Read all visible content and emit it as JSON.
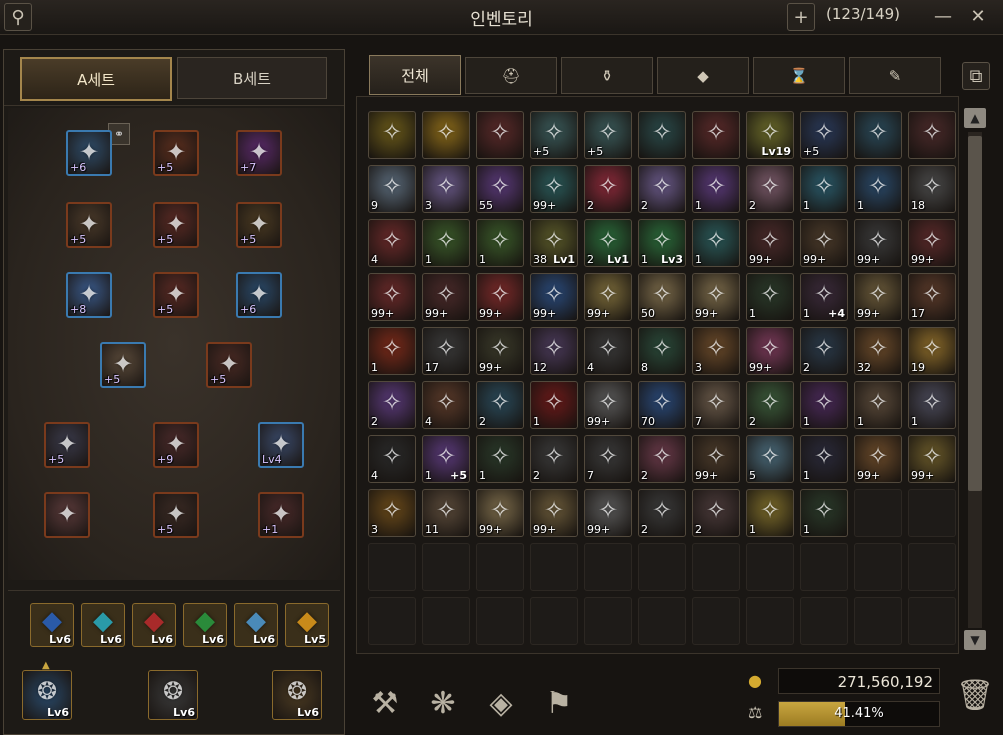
{
  "window": {
    "title": "인벤토리",
    "slot_count": "(123/149)",
    "icons": [
      "profile-search-icon",
      "plus-icon",
      "minimize-icon",
      "close-icon"
    ]
  },
  "sets": {
    "a": "A세트",
    "b": "B세트",
    "active": "a"
  },
  "equipment": [
    {
      "name": "helmet",
      "label": "+6",
      "color": "#2f4d6a"
    },
    {
      "name": "shoulder",
      "label": "+5",
      "color": "#5a2e1e"
    },
    {
      "name": "wing",
      "label": "+7",
      "color": "#5a2a6a"
    },
    {
      "name": "weapon",
      "label": "+5",
      "color": "#4a3a2a"
    },
    {
      "name": "chest",
      "label": "+5",
      "color": "#5a2a24"
    },
    {
      "name": "gloves",
      "label": "+5",
      "color": "#4a3a22"
    },
    {
      "name": "cloak",
      "label": "+8",
      "color": "#3a5a8a"
    },
    {
      "name": "pants",
      "label": "+5",
      "color": "#5a2a24"
    },
    {
      "name": "boots",
      "label": "+6",
      "color": "#2a4a6a"
    },
    {
      "name": "belt",
      "label": "+5",
      "color": "#5a4a3a"
    },
    {
      "name": "relic",
      "label": "+5",
      "color": "#4a2a24"
    },
    {
      "name": "necklace",
      "label": "+5",
      "color": "#3a3a4a"
    },
    {
      "name": "earring",
      "label": "+9",
      "color": "#4a2a2a"
    },
    {
      "name": "bracelet",
      "label": "Lv4",
      "color": "#3a4a6a"
    },
    {
      "name": "ring-wing",
      "label": "",
      "color": "#5a3a3a"
    },
    {
      "name": "ring-left",
      "label": "+5",
      "color": "#3a2a24"
    },
    {
      "name": "ring-right",
      "label": "+1",
      "color": "#4a2a2a"
    }
  ],
  "gems": [
    {
      "name": "sapphire",
      "lv": "Lv6",
      "color": "#2a5aa8"
    },
    {
      "name": "aquamarine",
      "lv": "Lv6",
      "color": "#2a9aa8"
    },
    {
      "name": "ruby",
      "lv": "Lv6",
      "color": "#a82a2a"
    },
    {
      "name": "emerald",
      "lv": "Lv6",
      "color": "#2a8a3a"
    },
    {
      "name": "opal",
      "lv": "Lv6",
      "color": "#4a8ab8"
    },
    {
      "name": "topaz",
      "lv": "Lv5",
      "color": "#c88a1a"
    }
  ],
  "artifacts": [
    {
      "name": "chain",
      "lv": "Lv6",
      "color": "#2a4a6a"
    },
    {
      "name": "bell",
      "lv": "Lv6",
      "color": "#3a3a3a"
    },
    {
      "name": "amulet",
      "lv": "Lv6",
      "color": "#4a3a22"
    }
  ],
  "category_tabs": [
    {
      "name": "all",
      "label": "전체"
    },
    {
      "name": "equipment",
      "label": "⛑"
    },
    {
      "name": "potion",
      "label": "⚱"
    },
    {
      "name": "material",
      "label": "◆"
    },
    {
      "name": "time",
      "label": "⌛"
    },
    {
      "name": "misc",
      "label": "✎"
    }
  ],
  "inventory": [
    {
      "q": "",
      "lv": "",
      "c": "#6a5a1a"
    },
    {
      "q": "",
      "lv": "",
      "c": "#8a6a1a"
    },
    {
      "q": "",
      "lv": "",
      "c": "#5a2a2a"
    },
    {
      "q": "+5",
      "lv": "",
      "c": "#3a5a5a"
    },
    {
      "q": "+5",
      "lv": "",
      "c": "#3a5a5a"
    },
    {
      "q": "",
      "lv": "",
      "c": "#2a4a4a"
    },
    {
      "q": "",
      "lv": "",
      "c": "#5a2a2a"
    },
    {
      "q": "",
      "lv": "Lv19",
      "c": "#6a6a2a"
    },
    {
      "q": "+5",
      "lv": "",
      "c": "#2a3a5a"
    },
    {
      "q": "",
      "lv": "",
      "c": "#2a4a5a"
    },
    {
      "q": "",
      "lv": "",
      "c": "#4a2a2a"
    },
    {
      "q": "9",
      "lv": "",
      "c": "#5a6a7a"
    },
    {
      "q": "3",
      "lv": "",
      "c": "#6a5a8a"
    },
    {
      "q": "55",
      "lv": "",
      "c": "#5a3a7a"
    },
    {
      "q": "99+",
      "lv": "",
      "c": "#2a5a5a"
    },
    {
      "q": "2",
      "lv": "",
      "c": "#8a2a3a"
    },
    {
      "q": "2",
      "lv": "",
      "c": "#6a5a8a"
    },
    {
      "q": "1",
      "lv": "",
      "c": "#5a3a7a"
    },
    {
      "q": "2",
      "lv": "",
      "c": "#7a5a6a"
    },
    {
      "q": "1",
      "lv": "",
      "c": "#2a5a6a"
    },
    {
      "q": "1",
      "lv": "",
      "c": "#2a4a6a"
    },
    {
      "q": "18",
      "lv": "",
      "c": "#4a4a4a"
    },
    {
      "q": "4",
      "lv": "",
      "c": "#6a2a2a"
    },
    {
      "q": "1",
      "lv": "",
      "c": "#3a5a2a"
    },
    {
      "q": "1",
      "lv": "",
      "c": "#3a5a2a"
    },
    {
      "q": "38",
      "lv": "Lv1",
      "c": "#5a5a2a"
    },
    {
      "q": "2",
      "lv": "Lv1",
      "c": "#2a6a3a"
    },
    {
      "q": "1",
      "lv": "Lv3",
      "c": "#2a6a3a"
    },
    {
      "q": "1",
      "lv": "",
      "c": "#2a5a5a"
    },
    {
      "q": "99+",
      "lv": "",
      "c": "#4a2a2a"
    },
    {
      "q": "99+",
      "lv": "",
      "c": "#4a3a2a"
    },
    {
      "q": "99+",
      "lv": "",
      "c": "#3a3a3a"
    },
    {
      "q": "99+",
      "lv": "",
      "c": "#5a2a2a"
    },
    {
      "q": "99+",
      "lv": "",
      "c": "#6a2a2a"
    },
    {
      "q": "99+",
      "lv": "",
      "c": "#4a2a2a"
    },
    {
      "q": "99+",
      "lv": "",
      "c": "#7a2a2a"
    },
    {
      "q": "99+",
      "lv": "",
      "c": "#2a4a7a"
    },
    {
      "q": "99+",
      "lv": "",
      "c": "#7a6a3a"
    },
    {
      "q": "50",
      "lv": "",
      "c": "#7a6a4a"
    },
    {
      "q": "99+",
      "lv": "",
      "c": "#7a6a4a"
    },
    {
      "q": "1",
      "lv": "",
      "c": "#2a3a2a"
    },
    {
      "q": "1",
      "lv": "+4",
      "c": "#3a2a3a"
    },
    {
      "q": "99+",
      "lv": "",
      "c": "#6a5a3a"
    },
    {
      "q": "17",
      "lv": "",
      "c": "#5a3a2a"
    },
    {
      "q": "1",
      "lv": "",
      "c": "#7a2a1a"
    },
    {
      "q": "17",
      "lv": "",
      "c": "#3a3a3a"
    },
    {
      "q": "99+",
      "lv": "",
      "c": "#3a3a2a"
    },
    {
      "q": "12",
      "lv": "",
      "c": "#4a3a5a"
    },
    {
      "q": "4",
      "lv": "",
      "c": "#3a3a3a"
    },
    {
      "q": "8",
      "lv": "",
      "c": "#2a4a3a"
    },
    {
      "q": "3",
      "lv": "",
      "c": "#6a4a2a"
    },
    {
      "q": "99+",
      "lv": "",
      "c": "#7a3a5a"
    },
    {
      "q": "2",
      "lv": "",
      "c": "#2a3a4a"
    },
    {
      "q": "32",
      "lv": "",
      "c": "#6a4a2a"
    },
    {
      "q": "19",
      "lv": "",
      "c": "#8a6a2a"
    },
    {
      "q": "2",
      "lv": "",
      "c": "#5a3a7a"
    },
    {
      "q": "4",
      "lv": "",
      "c": "#5a3a2a"
    },
    {
      "q": "2",
      "lv": "",
      "c": "#2a4a5a"
    },
    {
      "q": "1",
      "lv": "",
      "c": "#6a1a1a"
    },
    {
      "q": "99+",
      "lv": "",
      "c": "#5a5a5a"
    },
    {
      "q": "70",
      "lv": "",
      "c": "#2a4a7a"
    },
    {
      "q": "7",
      "lv": "",
      "c": "#6a5a4a"
    },
    {
      "q": "2",
      "lv": "",
      "c": "#3a5a3a"
    },
    {
      "q": "1",
      "lv": "",
      "c": "#4a2a5a"
    },
    {
      "q": "1",
      "lv": "",
      "c": "#5a4a3a"
    },
    {
      "q": "1",
      "lv": "",
      "c": "#4a4a5a"
    },
    {
      "q": "4",
      "lv": "",
      "c": "#2a2a2a"
    },
    {
      "q": "1",
      "lv": "+5",
      "c": "#5a3a7a"
    },
    {
      "q": "1",
      "lv": "",
      "c": "#2a3a2a"
    },
    {
      "q": "2",
      "lv": "",
      "c": "#3a3a3a"
    },
    {
      "q": "7",
      "lv": "",
      "c": "#3a3a3a"
    },
    {
      "q": "2",
      "lv": "",
      "c": "#6a3a4a"
    },
    {
      "q": "99+",
      "lv": "",
      "c": "#4a3a2a"
    },
    {
      "q": "5",
      "lv": "",
      "c": "#4a6a7a"
    },
    {
      "q": "1",
      "lv": "",
      "c": "#2a2a3a"
    },
    {
      "q": "99+",
      "lv": "",
      "c": "#6a4a2a"
    },
    {
      "q": "99+",
      "lv": "",
      "c": "#6a5a2a"
    },
    {
      "q": "3",
      "lv": "",
      "c": "#6a4a1a"
    },
    {
      "q": "11",
      "lv": "",
      "c": "#5a4a3a"
    },
    {
      "q": "99+",
      "lv": "",
      "c": "#7a6a4a"
    },
    {
      "q": "99+",
      "lv": "",
      "c": "#6a5a3a"
    },
    {
      "q": "99+",
      "lv": "",
      "c": "#5a5a5a"
    },
    {
      "q": "2",
      "lv": "",
      "c": "#3a3a3a"
    },
    {
      "q": "2",
      "lv": "",
      "c": "#4a3a3a"
    },
    {
      "q": "1",
      "lv": "",
      "c": "#7a6a2a"
    },
    {
      "q": "1",
      "lv": "",
      "c": "#2a3a2a"
    }
  ],
  "bottom_actions": [
    {
      "name": "anvil",
      "glyph": "⚒"
    },
    {
      "name": "dismantle",
      "glyph": "❋"
    },
    {
      "name": "craft",
      "glyph": "◈"
    },
    {
      "name": "storage",
      "glyph": "⚑"
    }
  ],
  "currency": {
    "gold": "271,560,192",
    "weight_text": "41.41%",
    "weight_fraction": 0.4141
  }
}
